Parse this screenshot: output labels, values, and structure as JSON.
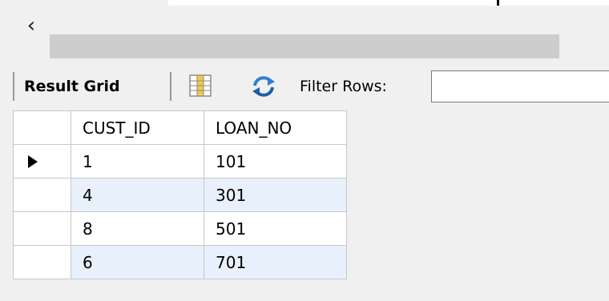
{
  "toolbar": {
    "result_grid_label": "Result Grid",
    "filter_label": "Filter Rows:",
    "filter_value": ""
  },
  "grid": {
    "columns": [
      "CUST_ID",
      "LOAN_NO"
    ],
    "rows": [
      [
        "1",
        "101"
      ],
      [
        "4",
        "301"
      ],
      [
        "8",
        "501"
      ],
      [
        "6",
        "701"
      ]
    ]
  },
  "icons": {
    "scroll_left": "chevron-left-icon",
    "grid_toggle": "form-grid-icon",
    "refresh": "refresh-icon"
  },
  "colors": {
    "alt_row": "#e8f0fb",
    "refresh_blue": "#2f7fd1",
    "grid_icon_yellow": "#f2c94c"
  }
}
